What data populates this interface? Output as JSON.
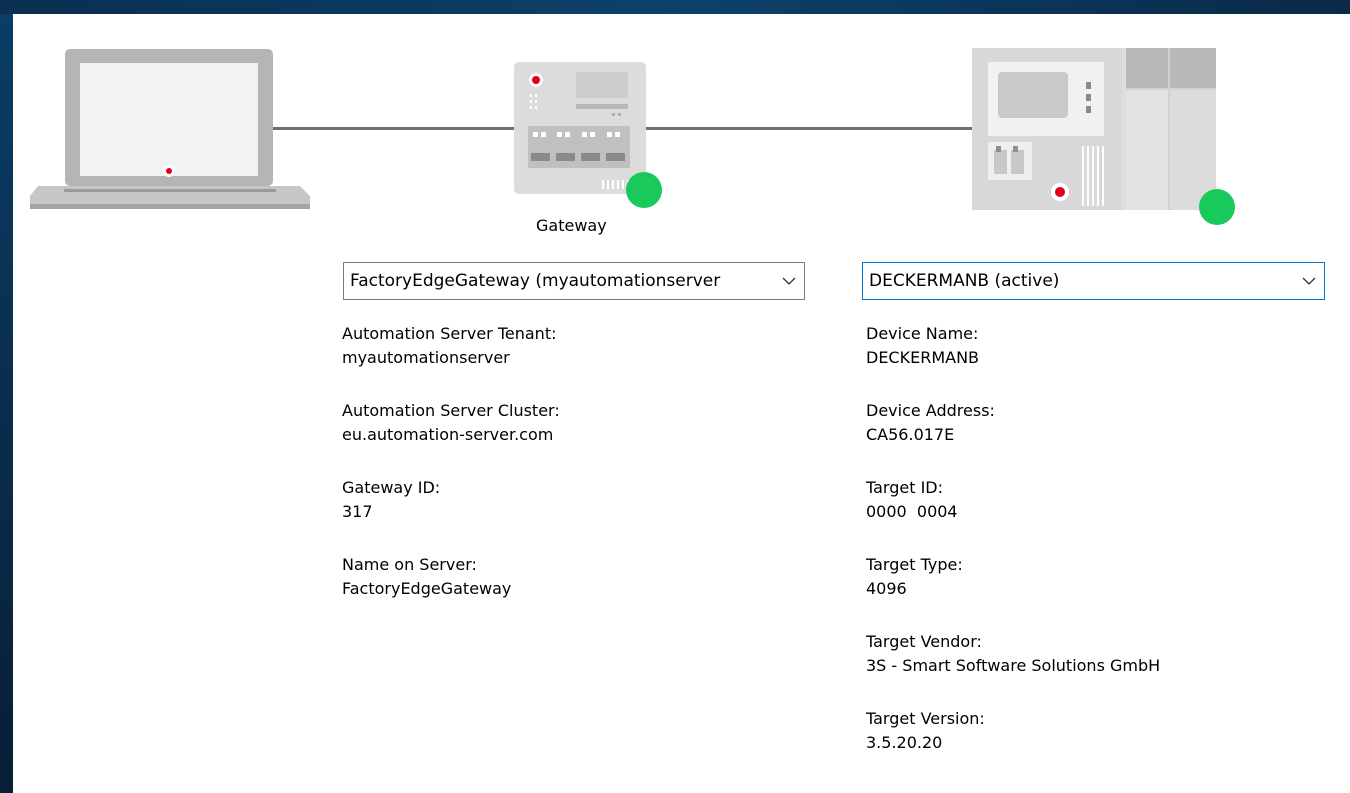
{
  "status_color": "#19c95b",
  "accent_red": "#e3001b",
  "gateway_caption": "Gateway",
  "gateway_select": {
    "value": "FactoryEdgeGateway (myautomationserver"
  },
  "device_select": {
    "value": "DECKERMANB (active)"
  },
  "gateway_info": [
    {
      "label": "Automation Server Tenant:",
      "value": "myautomationserver"
    },
    {
      "label": "Automation Server Cluster:",
      "value": "eu.automation-server.com"
    },
    {
      "label": "Gateway ID:",
      "value": "317"
    },
    {
      "label": "Name on Server:",
      "value": "FactoryEdgeGateway"
    }
  ],
  "device_info": [
    {
      "label": "Device Name:",
      "value": "DECKERMANB"
    },
    {
      "label": "Device Address:",
      "value": "CA56.017E"
    },
    {
      "label": "Target ID:",
      "value": "0000  0004"
    },
    {
      "label": "Target Type:",
      "value": "4096"
    },
    {
      "label": "Target Vendor:",
      "value": "3S - Smart Software Solutions GmbH"
    },
    {
      "label": "Target Version:",
      "value": "3.5.20.20"
    }
  ],
  "icons": {
    "computer": "laptop-icon",
    "gateway": "gateway-device-icon",
    "plc": "plc-device-icon",
    "dropdown": "chevron-down-icon"
  }
}
